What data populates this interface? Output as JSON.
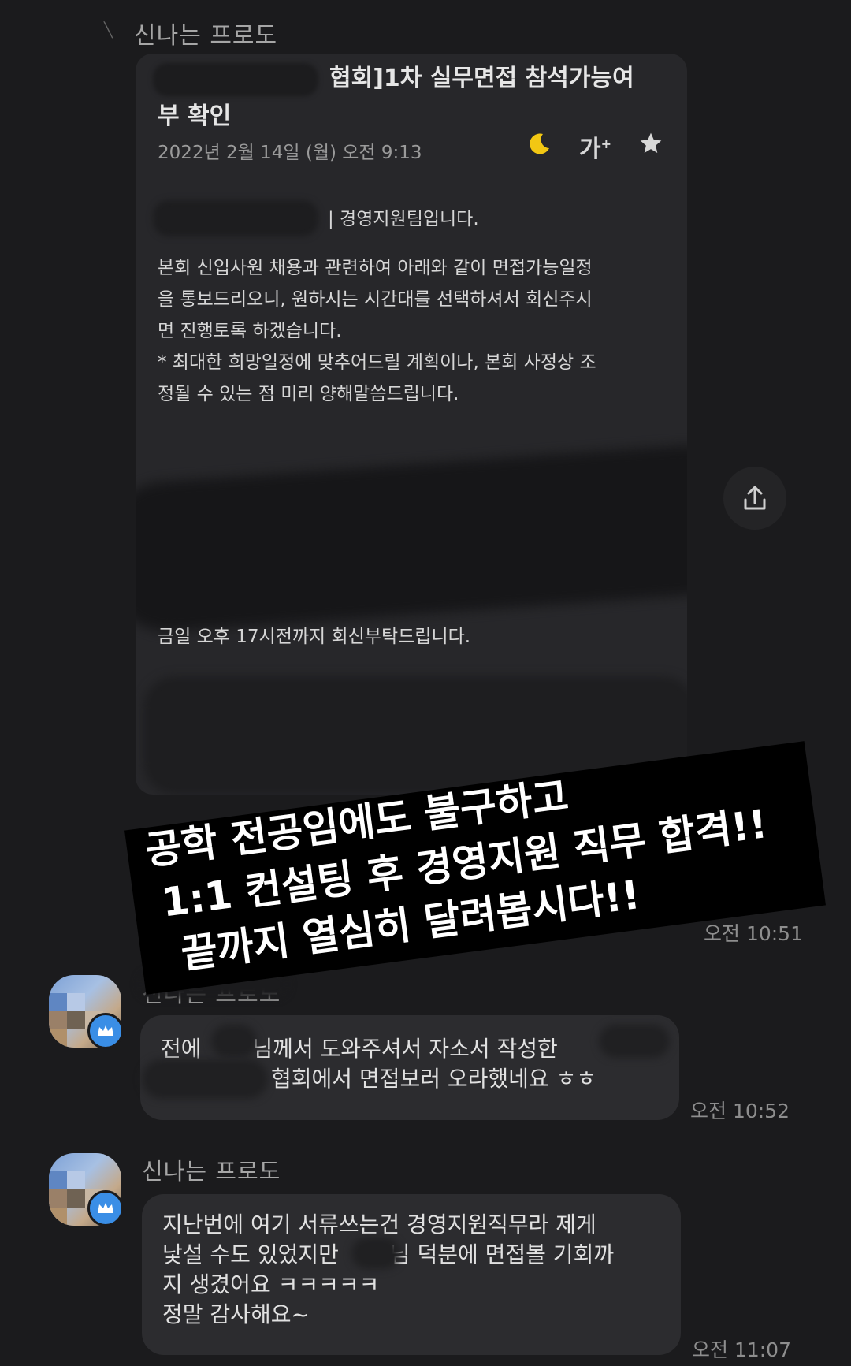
{
  "top_sender": "신나는 프로도",
  "email": {
    "title_line1": "협회]1차 실무면접 참석가능여",
    "title_line2": "부 확인",
    "date": "2022년 2월 14일 (월) 오전 9:13",
    "icons": [
      "moon-icon",
      "font-size-icon",
      "star-icon"
    ],
    "font_size_label": "가",
    "greeting": "| 경영지원팀입니다.",
    "paragraph1": "본회 신입사원 채용과 관련하여 아래와 같이 면접가능일정\n을 통보드리오니, 원하시는 시간대를 선택하셔서 회신주시\n면 진행토록 하겠습니다.\n* 최대한 희망일정에 맞추어드릴 계획이나, 본회 사정상 조\n정될 수 있는 점 미리 양해말씀드립니다.",
    "deadline": "금일 오후 17시전까지 회신부탁드립니다."
  },
  "banner": {
    "line1": "공학 전공임에도 불구하고",
    "line2": "1:1 컨설팅 후 경영지원 직무 합격!!",
    "line3": "끝까지 열심히 달려봅시다!!"
  },
  "times": {
    "t1": "오전 10:51",
    "t2": "오전 10:52",
    "t3": "오전 11:07"
  },
  "messages": [
    {
      "sender": "신나는 프로도",
      "text": "전에 　　님께서 도와주셔서 자소서 작성한 \n　　　　　협회에서 면접보러 오라했네요 ㅎㅎ"
    },
    {
      "sender": "신나는 프로도",
      "text": "지난번에 여기 서류쓰는건 경영지원직무라 제게\n낯설 수도 있었지만 　　님 덕분에 면접볼 기회까\n지 생겼어요 ㅋㅋㅋㅋㅋ\n정말 감사해요~"
    }
  ],
  "colors": {
    "background": "#1b1b1d",
    "bubble": "#2c2c2f",
    "moon": "#f2c713",
    "badge": "#3a8ee6",
    "banner": "#000000"
  }
}
